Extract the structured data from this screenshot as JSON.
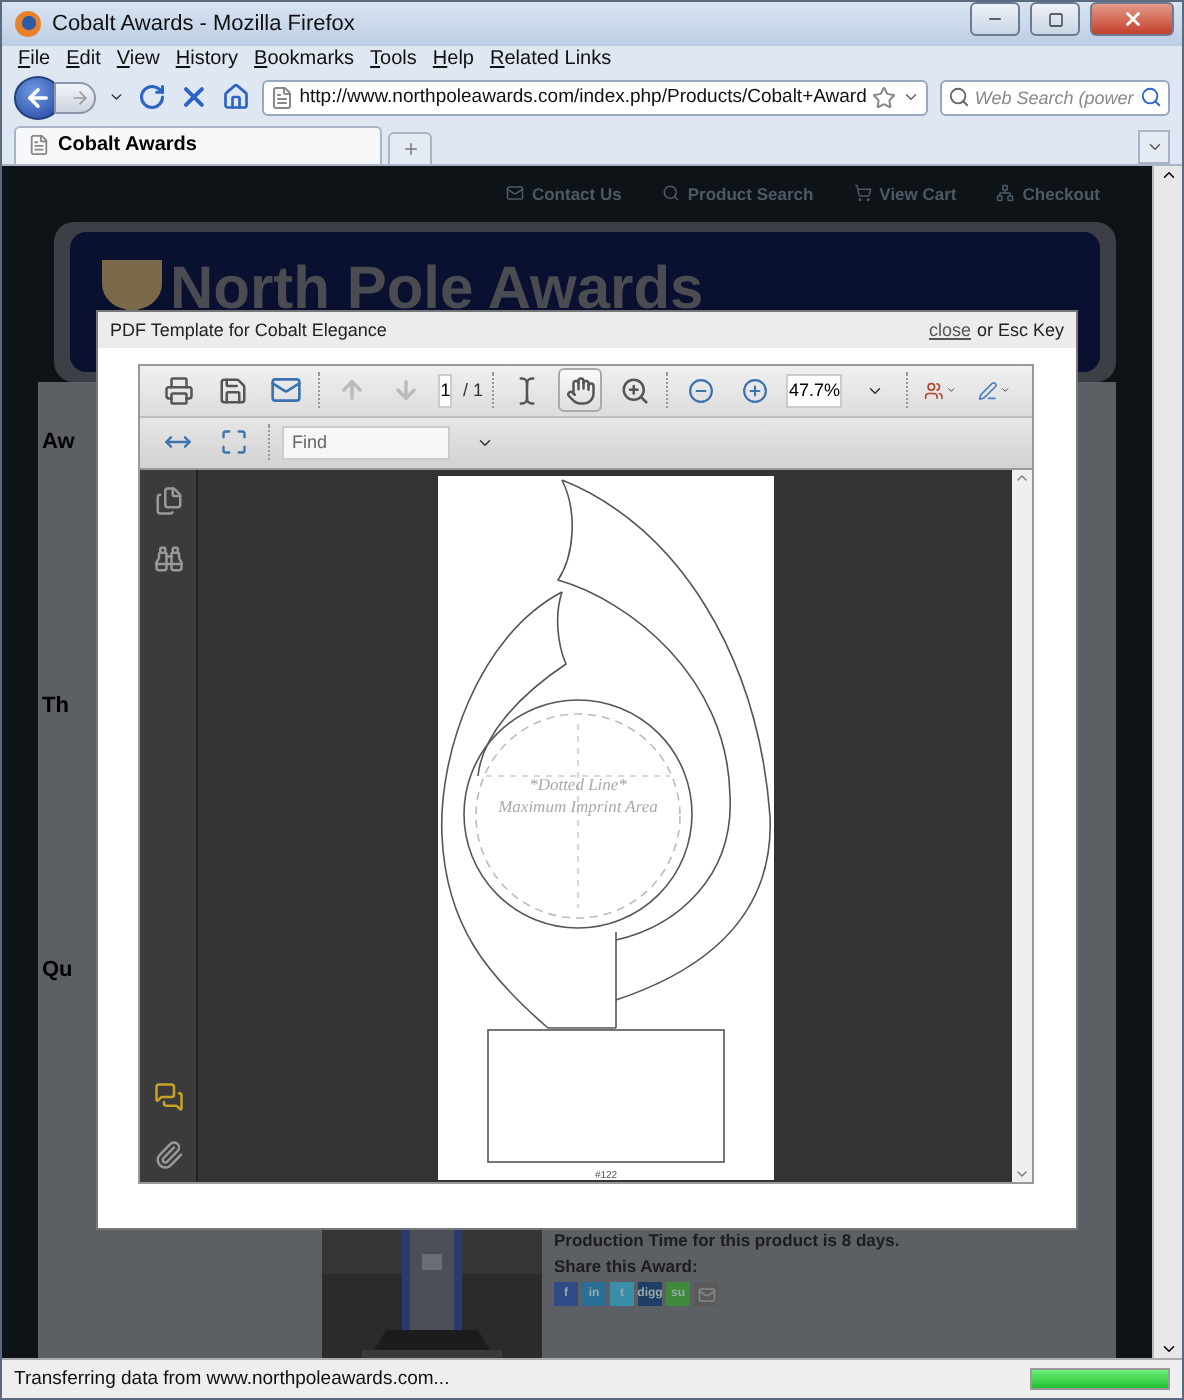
{
  "window": {
    "title": "Cobalt Awards - Mozilla Firefox"
  },
  "menu": [
    "File",
    "Edit",
    "View",
    "History",
    "Bookmarks",
    "Tools",
    "Help",
    "Related Links"
  ],
  "navbar": {
    "url": "http://www.northpoleawards.com/index.php/Products/Cobalt+Award",
    "search_placeholder": "Web Search (power"
  },
  "tabs": [
    {
      "label": "Cobalt Awards",
      "selected": true
    }
  ],
  "page": {
    "top_links": [
      {
        "kind": "contact",
        "label": "Contact Us"
      },
      {
        "kind": "search",
        "label": "Product Search"
      },
      {
        "kind": "cart",
        "label": "View Cart"
      },
      {
        "kind": "checkout",
        "label": "Checkout"
      }
    ],
    "banner_title": "North Pole Awards",
    "side_headings": [
      "Aw",
      "Th",
      "Qu"
    ],
    "production_note": "Production Time for this product is 8 days.",
    "share_label": "Share this Award:",
    "share_buttons": [
      {
        "kind": "text",
        "label": "f",
        "color": "#2f4a86"
      },
      {
        "kind": "text",
        "label": "in",
        "color": "#2a6f96"
      },
      {
        "kind": "text",
        "label": "t",
        "color": "#3a8ea8"
      },
      {
        "kind": "text",
        "label": "digg",
        "color": "#1d3f66"
      },
      {
        "kind": "text",
        "label": "su",
        "color": "#3c8a3a"
      },
      {
        "kind": "mail",
        "color": "#5a5a5a"
      }
    ]
  },
  "modal": {
    "title": "PDF Template for Cobalt Elegance",
    "close_link": "close",
    "close_hint": "or Esc Key",
    "viewer": {
      "page_number": "1",
      "page_total": "/ 1",
      "tools": [
        {
          "kind": "select",
          "selected": false
        },
        {
          "kind": "hand",
          "selected": true
        },
        {
          "kind": "zoom",
          "selected": false
        }
      ],
      "zoom": "47.7%",
      "find_placeholder": "Find",
      "document": {
        "label_line1": "*Dotted Line*",
        "label_line2": "Maximum Imprint Area",
        "footer": "#122"
      }
    }
  },
  "status_bar": {
    "text": "Transferring data from www.northpoleawards.com...",
    "progress": {
      "level": 1
    }
  }
}
